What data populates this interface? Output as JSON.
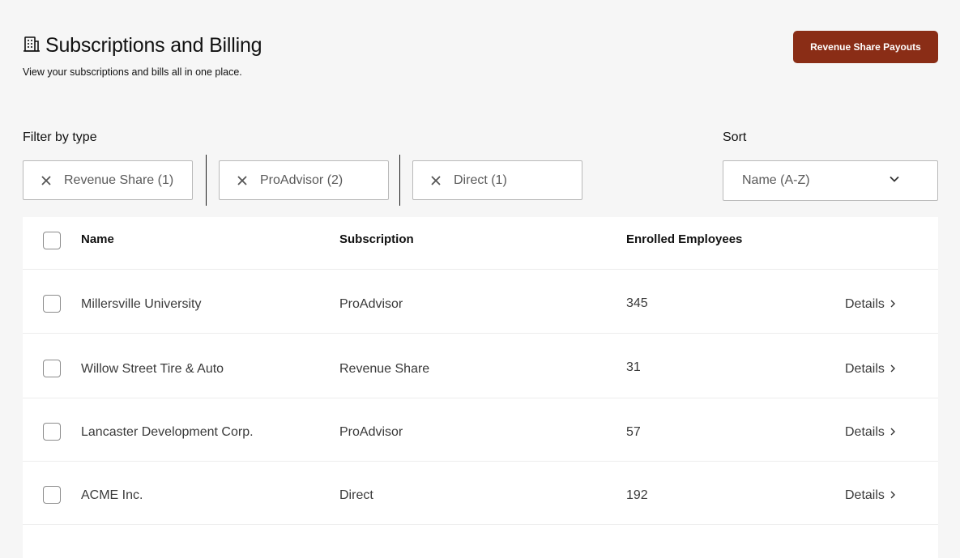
{
  "header": {
    "title": "Subscriptions and Billing",
    "subtitle": "View your subscriptions and bills all in one place.",
    "icon": "building-list-icon",
    "action_label": "Revenue Share Payouts",
    "action_color": "#8a2d16"
  },
  "filters": {
    "label": "Filter by type",
    "chips": [
      {
        "label": "Revenue Share (1)"
      },
      {
        "label": "ProAdvisor (2)"
      },
      {
        "label": "Direct (1)"
      }
    ]
  },
  "sort": {
    "label": "Sort",
    "value": "Name (A-Z)"
  },
  "table": {
    "columns": [
      "Name",
      "Subscription",
      "Enrolled Employees"
    ],
    "details_label": "Details",
    "rows": [
      {
        "name": "Millersville University",
        "subscription": "ProAdvisor",
        "employees": "345"
      },
      {
        "name": "Willow Street Tire & Auto",
        "subscription": "Revenue Share",
        "employees": "31"
      },
      {
        "name": "Lancaster Development Corp.",
        "subscription": "ProAdvisor",
        "employees": "57"
      },
      {
        "name": "ACME Inc.",
        "subscription": "Direct",
        "employees": "192"
      }
    ]
  }
}
